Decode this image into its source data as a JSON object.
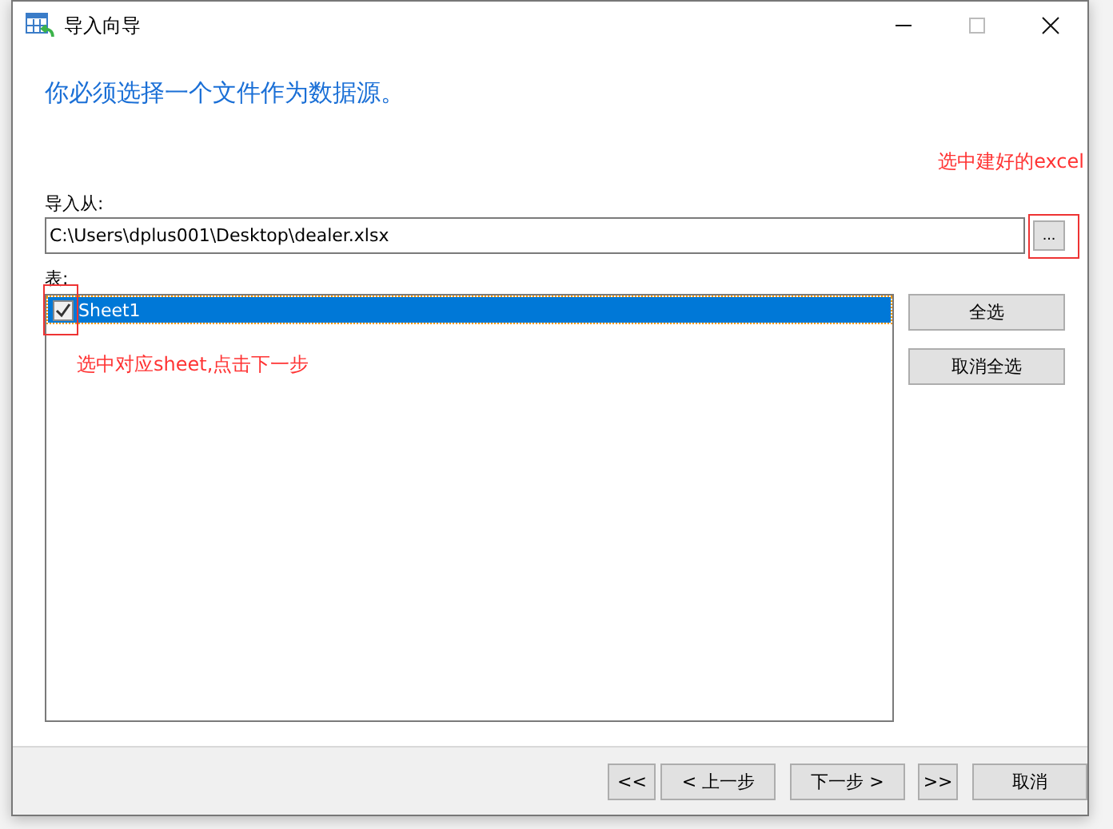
{
  "window": {
    "title": "导入向导"
  },
  "heading": "你必须选择一个文件作为数据源。",
  "source": {
    "label": "导入从:",
    "value": "C:\\Users\\dplus001\\Desktop\\dealer.xlsx",
    "browse": "..."
  },
  "tables": {
    "label": "表:",
    "items": [
      {
        "name": "Sheet1",
        "checked": true,
        "selected": true
      }
    ]
  },
  "side_buttons": [
    "全选",
    "取消全选"
  ],
  "footer_buttons": [
    "<<",
    "< 上一步",
    "下一步 >",
    ">>",
    "取消"
  ],
  "annotations": [
    "选中建好的excel",
    "选中对应sheet,点击下一步"
  ]
}
